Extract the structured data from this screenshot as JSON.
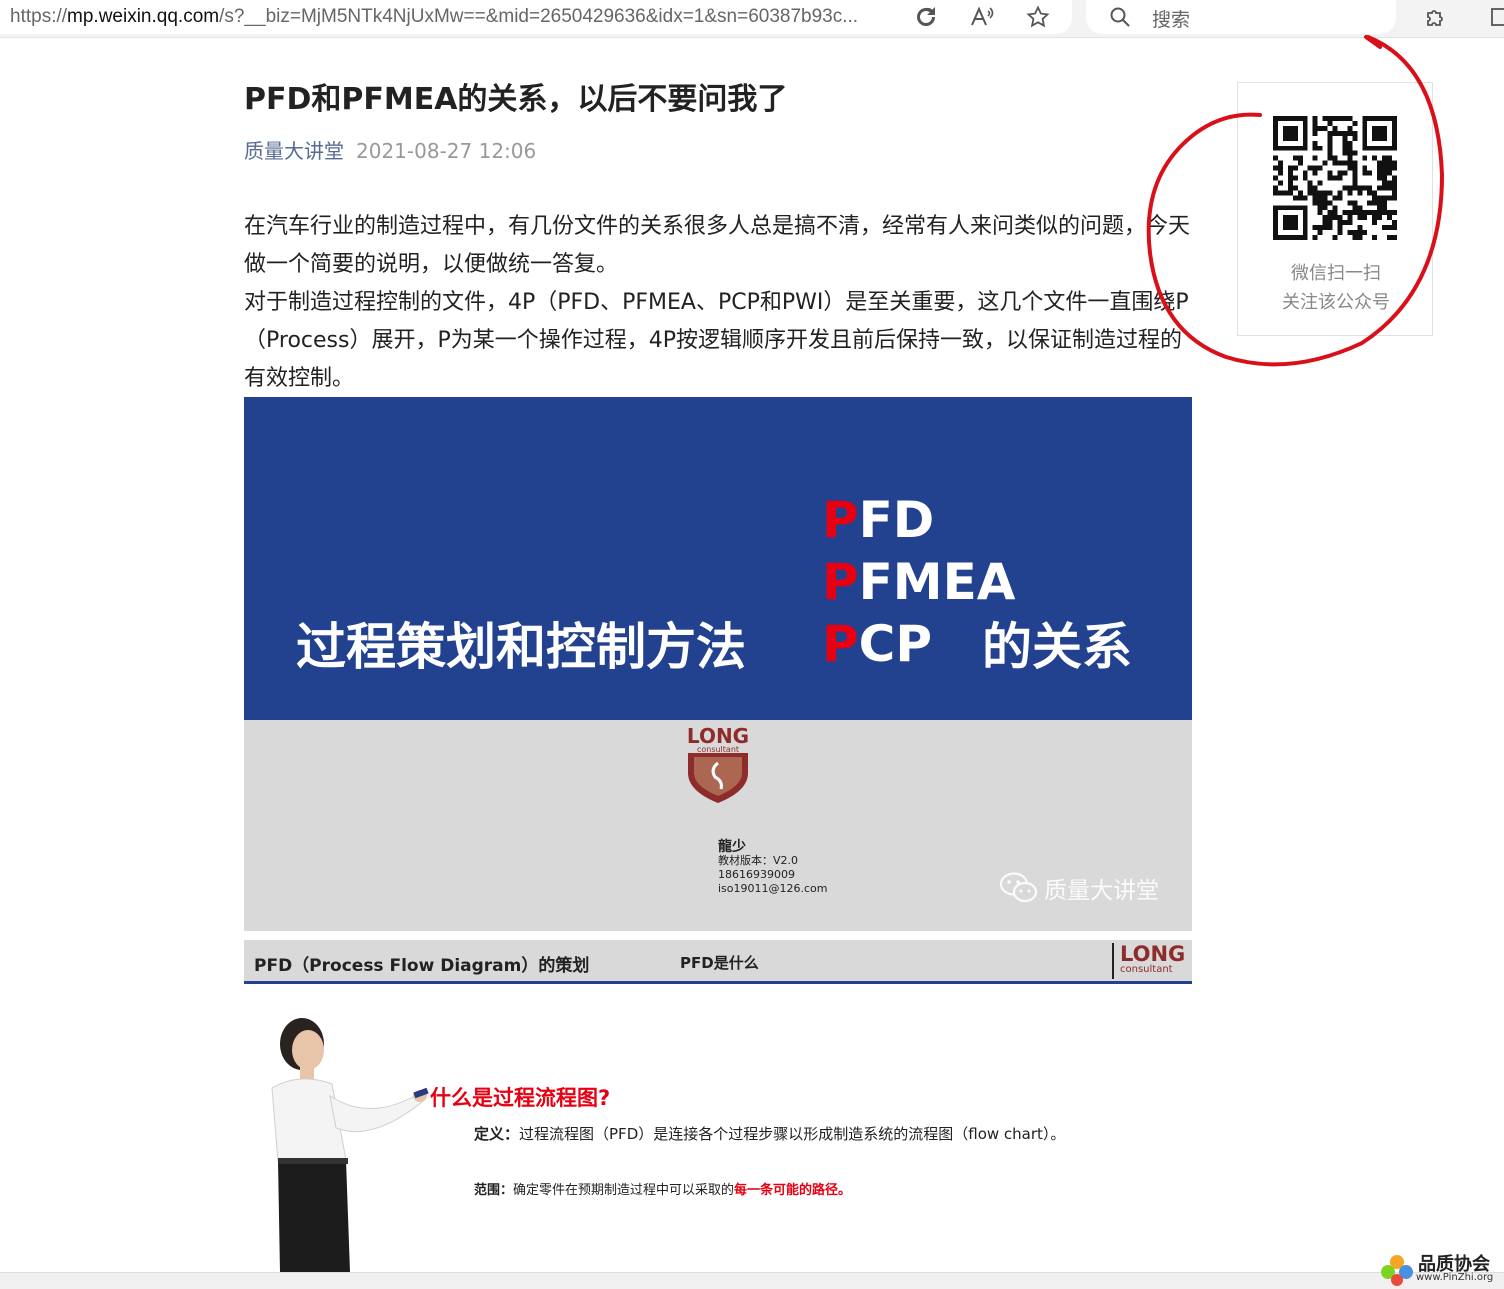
{
  "browser": {
    "url_prefix": "https://",
    "url_host": "mp.weixin.qq.com",
    "url_rest": "/s?__biz=MjM5NTk4NjUxMw==&mid=2650429636&idx=1&sn=60387b93c...",
    "search_placeholder": "搜索"
  },
  "article": {
    "title": "PFD和PFMEA的关系，以后不要问我了",
    "author": "质量大讲堂",
    "date": "2021-08-27 12:06",
    "paragraphs": [
      "在汽车行业的制造过程中，有几份文件的关系很多人总是搞不清，经常有人来问类似的问题，今天做一个简要的说明，以便做统一答复。",
      "对于制造过程控制的文件，4P（PFD、PFMEA、PCP和PWI）是至关重要，这几个文件一直围绕P（Process）展开，P为某一个操作过程，4P按逻辑顺序开发且前后保持一致，以保证制造过程的有效控制。"
    ]
  },
  "slide1": {
    "main_title": "过程策划和控制方法",
    "stack": [
      {
        "first": "P",
        "rest": "FD"
      },
      {
        "first": "P",
        "rest": "FMEA"
      },
      {
        "first": "P",
        "rest": "CP"
      }
    ],
    "relation": "的关系",
    "logo_text": "LONG",
    "logo_sub": "consultant",
    "author_name": "龍少",
    "version": "教材版本：V2.0",
    "phone": "18616939009",
    "email": "iso19011@126.com",
    "watermark": "质量大讲堂"
  },
  "slide2": {
    "header_title": "PFD（Process Flow Diagram）的策划",
    "header_sub": "PFD是什么",
    "logo_text": "LONG",
    "logo_sub": "consultant",
    "question": "什么是过程流程图?",
    "def_label": "定义：",
    "def_text": "过程流程图（PFD）是连接各个过程步骤以形成制造系统的流程图（flow chart）。",
    "scope_label": "范围：",
    "scope_text": "确定零件在预期制造过程中可以采取的",
    "scope_highlight": "每一条可能的路径。"
  },
  "qr": {
    "caption_line1": "微信扫一扫",
    "caption_line2": "关注该公众号"
  },
  "corner_logo": {
    "name": "品质协会",
    "url": "www.PinZhi.org"
  },
  "colors": {
    "slide_blue": "#22418f",
    "accent_red": "#e60012",
    "author_link": "#576b95",
    "annotation_red": "#d9101a"
  }
}
